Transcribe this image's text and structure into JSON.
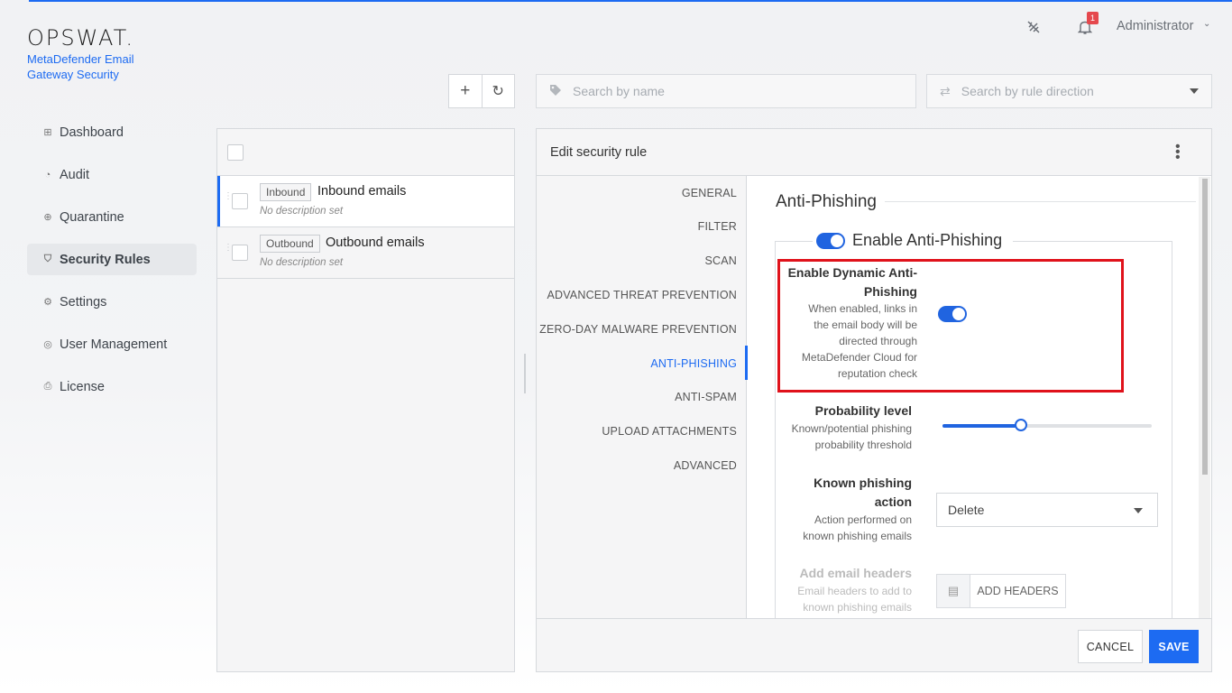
{
  "header": {
    "logo": "OPSWAT.",
    "product": "MetaDefender Email Gateway Security",
    "notification_count": "1",
    "user": "Administrator"
  },
  "sidebar": {
    "items": [
      {
        "label": "Dashboard",
        "icon": "dashboard-icon"
      },
      {
        "label": "Audit",
        "icon": "audit-icon"
      },
      {
        "label": "Quarantine",
        "icon": "quarantine-icon"
      },
      {
        "label": "Security Rules",
        "icon": "shield-icon"
      },
      {
        "label": "Settings",
        "icon": "gear-icon"
      },
      {
        "label": "User Management",
        "icon": "user-icon"
      },
      {
        "label": "License",
        "icon": "license-icon"
      }
    ]
  },
  "toolbar": {
    "search_name_placeholder": "Search by name",
    "search_direction_placeholder": "Search by rule direction"
  },
  "rules": [
    {
      "tag": "Inbound",
      "name": "Inbound emails",
      "description": "No description set"
    },
    {
      "tag": "Outbound",
      "name": "Outbound emails",
      "description": "No description set"
    }
  ],
  "edit": {
    "title": "Edit security rule",
    "tabs": [
      "GENERAL",
      "FILTER",
      "SCAN",
      "ADVANCED THREAT PREVENTION",
      "ZERO-DAY MALWARE PREVENTION",
      "ANTI-PHISHING",
      "ANTI-SPAM",
      "UPLOAD ATTACHMENTS",
      "ADVANCED"
    ],
    "active_tab": "ANTI-PHISHING",
    "section_title": "Anti-Phishing",
    "enable_label": "Enable Anti-Phishing",
    "dynamic": {
      "label_1": "Enable Dynamic Anti-",
      "label_2": "Phishing",
      "hint_1": "When enabled, links in",
      "hint_2": "the email body will be",
      "hint_3": "directed through",
      "hint_4": "MetaDefender Cloud for",
      "hint_5": "reputation check"
    },
    "probability": {
      "label": "Probability level",
      "hint_1": "Known/potential phishing",
      "hint_2": "probability threshold",
      "value_fraction": 0.375
    },
    "known_action": {
      "label_1": "Known phishing",
      "label_2": "action",
      "hint_1": "Action performed on",
      "hint_2": "known phishing emails",
      "value": "Delete"
    },
    "headers": {
      "label": "Add email headers",
      "hint_1": "Email headers to add to",
      "hint_2": "known phishing emails",
      "button": "ADD HEADERS"
    },
    "cancel": "CANCEL",
    "save": "SAVE"
  },
  "colors": {
    "accent": "#1d6bf2",
    "highlight": "#e0121b"
  }
}
